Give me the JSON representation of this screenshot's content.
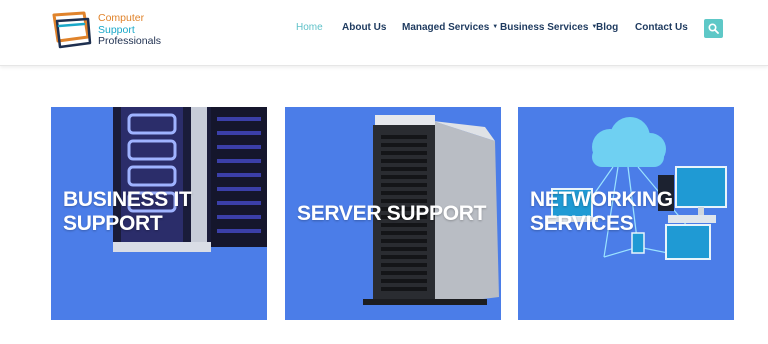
{
  "brand": {
    "line1": "Computer",
    "line2": "Support",
    "line3": "Professionals",
    "colors": {
      "orange": "#e0832b",
      "teal": "#1aa8c9",
      "navy": "#1e2f4f"
    }
  },
  "nav": {
    "items": [
      {
        "label": "Home",
        "active": true,
        "has_dropdown": false
      },
      {
        "label": "About Us",
        "active": false,
        "has_dropdown": false
      },
      {
        "label": "Managed Services",
        "active": false,
        "has_dropdown": true
      },
      {
        "label": "Business Services",
        "active": false,
        "has_dropdown": true
      },
      {
        "label": "Blog",
        "active": false,
        "has_dropdown": false
      },
      {
        "label": "Contact Us",
        "active": false,
        "has_dropdown": false
      }
    ],
    "dropdown_icon": "caret-down-icon",
    "search_icon": "search-icon",
    "accent_color": "#5ec8c7"
  },
  "cards": [
    {
      "title_line1": "BUSINESS IT",
      "title_line2": "SUPPORT",
      "image": "server-rack-interior"
    },
    {
      "title_line1": "SERVER SUPPORT",
      "title_line2": "",
      "image": "tower-server"
    },
    {
      "title_line1": "NETWORKING",
      "title_line2": "SERVICES",
      "image": "cloud-network-devices"
    }
  ],
  "card_color": "#4b7de8"
}
